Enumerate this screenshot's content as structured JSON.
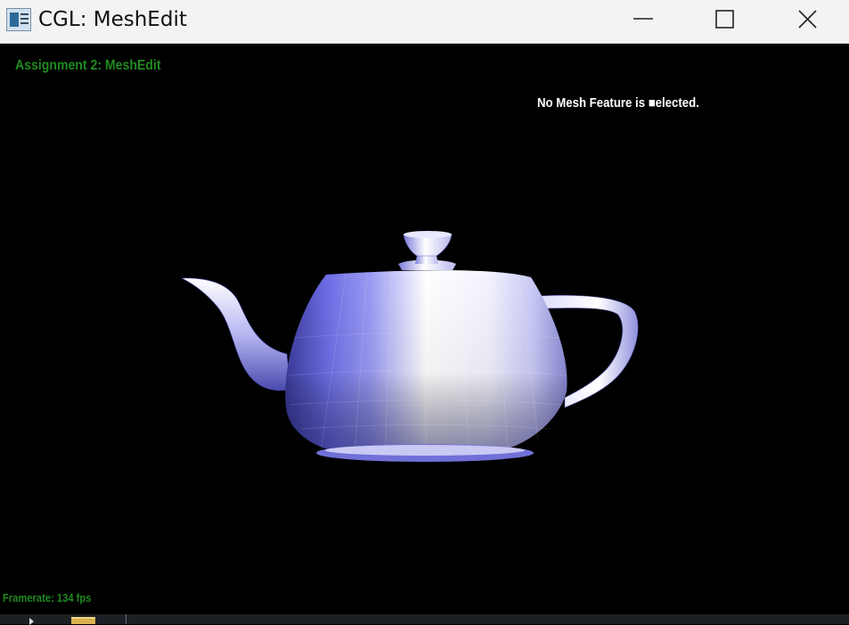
{
  "window": {
    "title": "CGL: MeshEdit",
    "icon": "app-window-icon",
    "controls": [
      "minimize-icon",
      "maximize-icon",
      "close-icon"
    ]
  },
  "viewport": {
    "assignment_title": "Assignment 2: MeshEdit",
    "selection_status": "No Mesh Feature is ■elected.",
    "framerate": "Framerate: 134 fps",
    "model": "teapot",
    "background_color": "#000000",
    "hud_color": "#1f8a1f",
    "mesh_color": "#8080ff"
  },
  "taskbar": {
    "items": [
      "chevron-right-icon",
      "file-explorer-icon"
    ]
  }
}
